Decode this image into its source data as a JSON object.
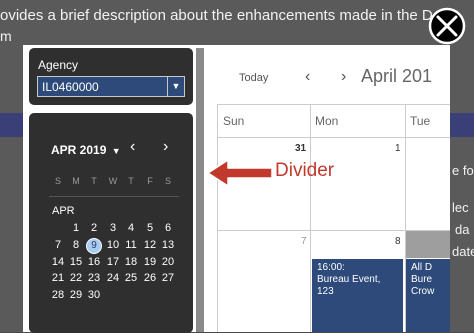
{
  "background": {
    "line1": "ovides a brief description about the enhancements made in the D",
    "line2": "m",
    "side_right": "e fo",
    "side_right2": "lec",
    "side_right3": "da",
    "side_right4": "date",
    "band_color": "#3a3f78"
  },
  "agency": {
    "label": "Agency",
    "value": "IL0460000"
  },
  "mini_calendar": {
    "month_title": "APR 2019",
    "weekdays": [
      "S",
      "M",
      "T",
      "W",
      "T",
      "F",
      "S"
    ],
    "month_label": "APR",
    "weeks": [
      [
        "",
        "1",
        "2",
        "3",
        "4",
        "5",
        "6"
      ],
      [
        "7",
        "8",
        "9",
        "10",
        "11",
        "12",
        "13"
      ],
      [
        "14",
        "15",
        "16",
        "17",
        "18",
        "19",
        "20"
      ],
      [
        "21",
        "22",
        "23",
        "24",
        "25",
        "26",
        "27"
      ],
      [
        "28",
        "29",
        "30",
        "",
        "",
        "",
        ""
      ]
    ],
    "today": "9"
  },
  "main_calendar": {
    "today_label": "Today",
    "title": "April 201",
    "day_names": [
      "Sun",
      "Mon",
      "Tue"
    ],
    "row1_dates": [
      "31",
      "1"
    ],
    "row2_dates": [
      "7",
      "8"
    ],
    "events": [
      {
        "time": "16:00:",
        "title": "Bureau Event,",
        "extra": "123"
      },
      {
        "time": "All D",
        "title": "Bure",
        "extra": "Crow"
      }
    ]
  },
  "annotation": {
    "label": "Divider",
    "color": "#c0392b"
  },
  "close_icon": "close-icon"
}
